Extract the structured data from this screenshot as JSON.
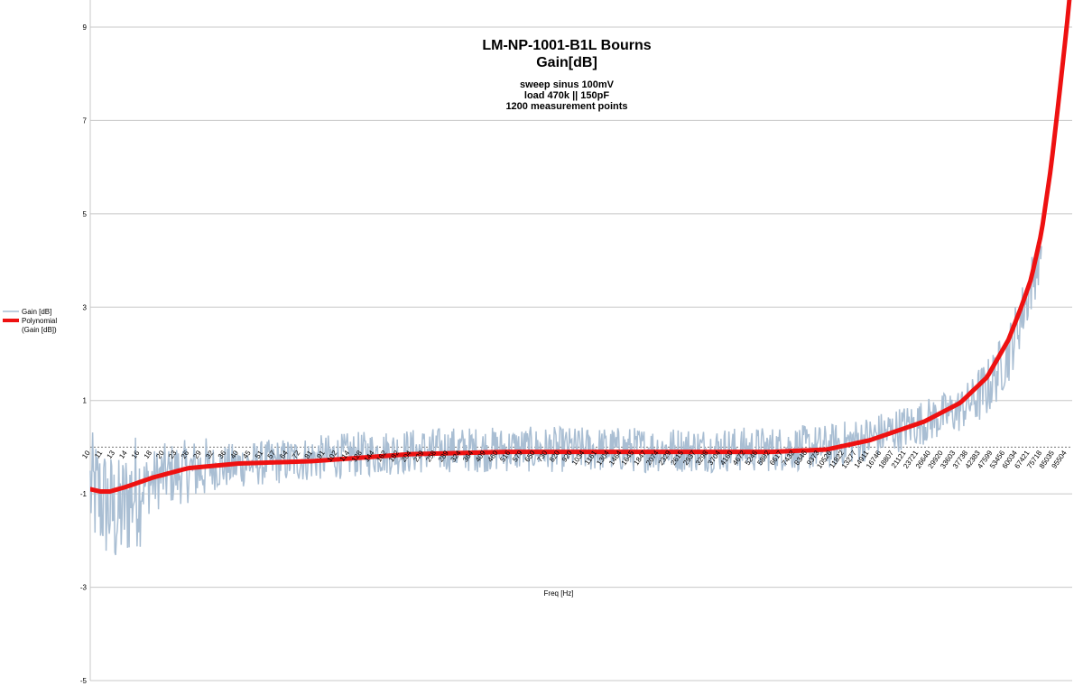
{
  "chart_data": {
    "type": "line",
    "title": "LM-NP-1001-B1L Bourns",
    "title2": "Gain[dB]",
    "subtitle_lines": [
      "sweep sinus 100mV",
      "load 470k || 150pF",
      "1200 measurement points"
    ],
    "xlabel": "Freq [Hz]",
    "ylabel": "",
    "ylim": [
      -5,
      10
    ],
    "yticks": [
      9,
      7,
      5,
      3,
      1,
      -1,
      -3,
      -5
    ],
    "grid": true,
    "legend_position": "left",
    "x_tick_labels": [
      "10",
      "11",
      "13",
      "14",
      "16",
      "18",
      "20",
      "23",
      "26",
      "29",
      "32",
      "36",
      "40",
      "45",
      "51",
      "57",
      "64",
      "72",
      "81",
      "91",
      "102",
      "114",
      "128",
      "144",
      "162",
      "182",
      "204",
      "229",
      "258",
      "289",
      "324",
      "364",
      "409",
      "460",
      "516",
      "579",
      "650",
      "730",
      "820",
      "920",
      "1034",
      "1161",
      "1304",
      "1464",
      "1645",
      "1847",
      "2074",
      "2329",
      "2615",
      "2937",
      "3298",
      "3704",
      "4160",
      "4672",
      "5246",
      "5892",
      "6617",
      "7432",
      "8346",
      "9373",
      "10526",
      "11822",
      "13277",
      "14911",
      "16746",
      "18807",
      "21121",
      "23721",
      "26640",
      "29920",
      "33603",
      "37738",
      "42383",
      "47599",
      "53456",
      "60034",
      "67421",
      "75718",
      "85035",
      "95504"
    ],
    "series": [
      {
        "name": "Gain [dB]",
        "color": "#a9bed3",
        "x_range": [
          10,
          100000
        ],
        "points": 1200,
        "base_curve": [
          [
            10,
            -0.9
          ],
          [
            12,
            -1.3
          ],
          [
            13,
            -1.5
          ],
          [
            15,
            -0.95
          ],
          [
            20,
            -0.6
          ],
          [
            30,
            -0.45
          ],
          [
            60,
            -0.3
          ],
          [
            150,
            -0.12
          ],
          [
            300,
            -0.05
          ],
          [
            1000,
            -0.05
          ],
          [
            5000,
            -0.05
          ],
          [
            10000,
            0.0
          ],
          [
            15000,
            0.2
          ],
          [
            25000,
            0.55
          ],
          [
            35000,
            0.8
          ],
          [
            45000,
            1.25
          ],
          [
            55000,
            2.0
          ],
          [
            62000,
            2.8
          ],
          [
            70000,
            3.7
          ],
          [
            75000,
            4.4
          ]
        ],
        "noise_amplitude_db": 0.35,
        "observed_min": -2.9,
        "observed_max": 4.4
      },
      {
        "name": "Polynomial (Gain [dB])",
        "legend_lines": [
          "Polynomial",
          "(Gain [dB])"
        ],
        "color": "#ee1111",
        "x": [
          10,
          11,
          12,
          14,
          18,
          25,
          40,
          80,
          200,
          500,
          1000,
          3000,
          6000,
          10000,
          15000,
          25000,
          35000,
          45000,
          55000,
          62000,
          68000,
          75000,
          82000,
          88000,
          95000,
          100000
        ],
        "y": [
          -0.9,
          -0.95,
          -0.95,
          -0.85,
          -0.65,
          -0.45,
          -0.35,
          -0.3,
          -0.15,
          -0.1,
          -0.1,
          -0.1,
          -0.1,
          -0.05,
          0.15,
          0.55,
          0.95,
          1.5,
          2.3,
          3.0,
          3.6,
          4.6,
          6.0,
          7.4,
          9.0,
          10.2
        ]
      }
    ],
    "zero_line": 0
  }
}
